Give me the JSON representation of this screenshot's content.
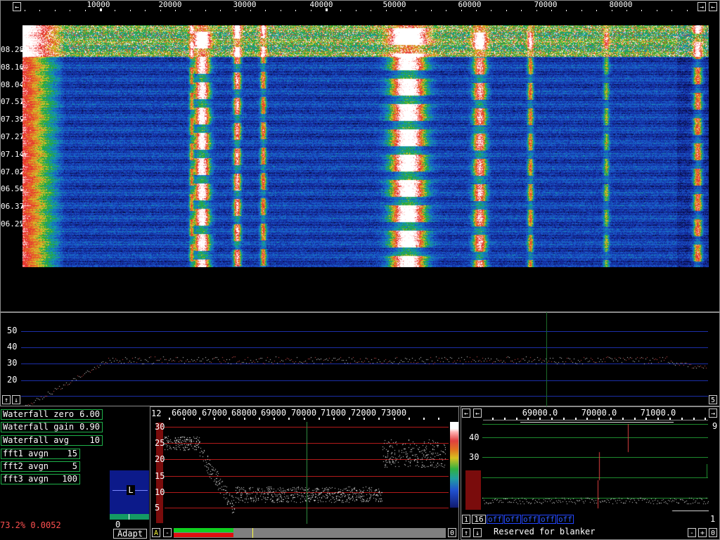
{
  "waterfall": {
    "freq_ticks": [
      "10000",
      "20000",
      "30000",
      "40000",
      "50000",
      "60000",
      "70000",
      "80000"
    ],
    "time_labels": [
      "08.28",
      "08.16",
      "08.04",
      "07.51",
      "07.39",
      "07.27",
      "07.14",
      "07.02",
      "06.50",
      "06.37",
      "06.25"
    ]
  },
  "spectrum": {
    "y_labels": [
      "50",
      "40",
      "30",
      "20"
    ],
    "right_button": "5"
  },
  "params": [
    {
      "label": "Waterfall zero",
      "value": "6.00"
    },
    {
      "label": "Waterfall gain",
      "value": "0.90"
    },
    {
      "label": "Waterfall avg",
      "value": "10"
    },
    {
      "label": "fft1 avgn",
      "value": "15"
    },
    {
      "label": "fft2 avgn",
      "value": "5"
    },
    {
      "label": "fft3 avgn",
      "value": "100"
    }
  ],
  "status": {
    "cpu_text": "73.2% 0.0052",
    "meter_letter": "L",
    "meter_value": "0",
    "adapt_label": "Adapt"
  },
  "baseband": {
    "top_left_num": "12",
    "freq_ticks": [
      "66000",
      "67000",
      "68000",
      "69000",
      "70000",
      "71000",
      "72000",
      "73000"
    ],
    "y_labels": [
      "30",
      "25",
      "20",
      "15",
      "10",
      "5"
    ],
    "a_button": "A",
    "minus_button": "-",
    "right_num": "0"
  },
  "hires": {
    "freq_ticks": [
      "69000.0",
      "70000.0",
      "71000.0"
    ],
    "y_labels": [
      "40",
      "30",
      "20",
      "10"
    ],
    "top_right_num": "9",
    "bottom_right_num": "1",
    "btn_1": "1",
    "btn_16": "16",
    "off_labels": [
      "off",
      "off",
      "off",
      "off",
      "off"
    ],
    "blanker_text": "Reserved for blanker",
    "minus": "-",
    "plus": "+",
    "zero": "0"
  }
}
